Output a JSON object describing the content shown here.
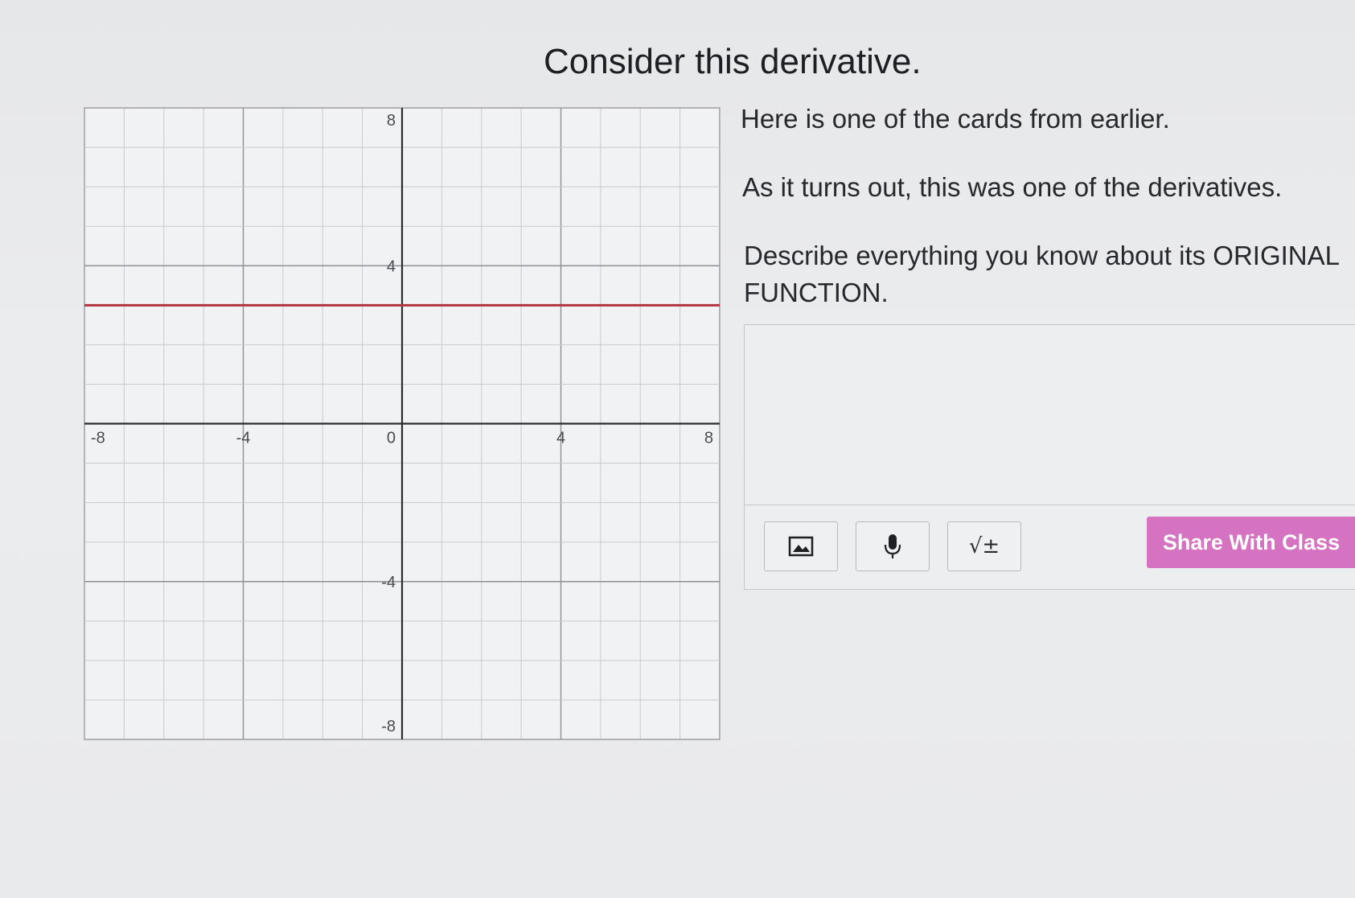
{
  "page": {
    "title": "Consider this derivative."
  },
  "prompt": {
    "line1": "Here is one of the cards from earlier.",
    "line2": "As it turns out, this was one of the derivatives.",
    "line3": "Describe everything you know about its ORIGINAL",
    "line4": "FUNCTION."
  },
  "response": {
    "value": "",
    "placeholder": ""
  },
  "toolbar": {
    "image_icon": "image-icon",
    "mic_icon": "microphone-icon",
    "math_label": "√±",
    "share_label": "Share With Class"
  },
  "colors": {
    "line": "#b3333f",
    "share_button": "#d572c2",
    "grid": "#c9cacd",
    "axis": "#2b2c2f"
  },
  "chart_data": {
    "type": "line",
    "title": "",
    "xlabel": "",
    "ylabel": "",
    "xlim": [
      -8,
      8
    ],
    "ylim": [
      -8,
      8
    ],
    "grid": true,
    "xticks": [
      "-8",
      "-4",
      "0",
      "4",
      "8"
    ],
    "yticks": [
      "8",
      "4",
      "-4",
      "-8"
    ],
    "series": [
      {
        "x": [
          -8,
          8
        ],
        "y": [
          3,
          3
        ]
      }
    ]
  }
}
